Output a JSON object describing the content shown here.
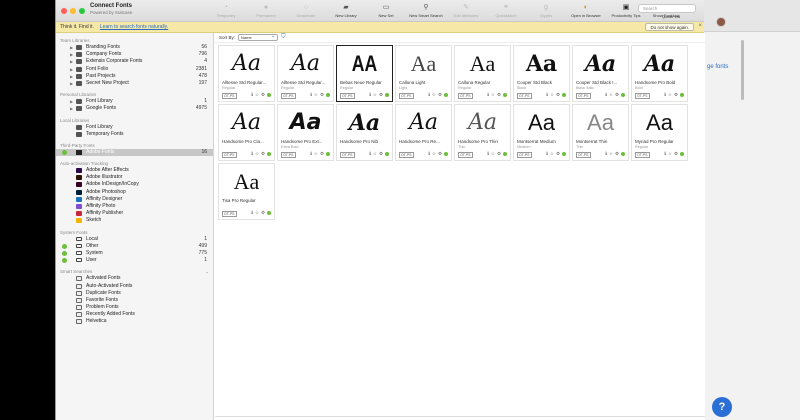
{
  "app": {
    "title": "Connect Fonts",
    "subtitle": "Powered by Suitcase"
  },
  "toolbar": [
    {
      "label": "Temporary",
      "icon": "temporary-icon",
      "dim": true
    },
    {
      "label": "Permanent",
      "icon": "permanent-icon",
      "dim": true
    },
    {
      "label": "Deactivate",
      "icon": "deactivate-icon",
      "dim": true
    },
    {
      "label": "New Library",
      "icon": "new-library-icon",
      "dim": false
    },
    {
      "label": "New Set",
      "icon": "new-set-icon",
      "dim": false
    },
    {
      "label": "New Smart Search",
      "icon": "smart-search-icon",
      "dim": false
    },
    {
      "label": "Edit Attributes",
      "icon": "edit-attributes-icon",
      "dim": true
    },
    {
      "label": "QuickMatch",
      "icon": "quickmatch-icon",
      "dim": true
    },
    {
      "label": "Glyphs",
      "icon": "glyphs-icon",
      "dim": true
    },
    {
      "label": "Open in Browser",
      "icon": "open-browser-icon",
      "dim": false
    },
    {
      "label": "Productivity Tips",
      "icon": "productivity-tips-icon",
      "dim": false
    },
    {
      "label": "Show Font List",
      "icon": "font-list-icon",
      "dim": false
    }
  ],
  "search": {
    "placeholder": "Search",
    "quickfind": "QuickFind"
  },
  "banner": {
    "text": "Think it. Find it.",
    "link": "Learn to search fonts naturally.",
    "dismiss": "Do not show again.",
    "close": "×"
  },
  "sidebar": {
    "team_libraries": {
      "header": "Team Libraries",
      "items": [
        {
          "label": "Branding Fonts",
          "count": "56"
        },
        {
          "label": "Company Fonts",
          "count": "796"
        },
        {
          "label": "Extensis Corporate Fonts",
          "count": "4"
        },
        {
          "label": "Font Folio",
          "count": "2381"
        },
        {
          "label": "Past Projects",
          "count": "478"
        },
        {
          "label": "Secret New Project",
          "count": "197"
        }
      ]
    },
    "personal_libraries": {
      "header": "Personal Libraries",
      "items": [
        {
          "label": "Font Library",
          "count": "1"
        },
        {
          "label": "Google Fonts",
          "count": "4975"
        }
      ]
    },
    "local_libraries": {
      "header": "Local Libraries",
      "items": [
        {
          "label": "Font Library",
          "count": ""
        },
        {
          "label": "Temporary Fonts",
          "count": ""
        }
      ]
    },
    "third_party": {
      "header": "Third-Party Fonts",
      "items": [
        {
          "label": "Adobe Fonts",
          "count": "16"
        }
      ]
    },
    "auto_activation": {
      "header": "Auto-activation Tracking",
      "items": [
        {
          "label": "Adobe After Effects",
          "color": "#2a0a4a",
          "fg": "#b58cff"
        },
        {
          "label": "Adobe Illustrator",
          "color": "#2b1500",
          "fg": "#ff9a00"
        },
        {
          "label": "Adobe InDesign/InCopy",
          "color": "#3a0020",
          "fg": "#ff3d8c"
        },
        {
          "label": "Adobe Photoshop",
          "color": "#001e36",
          "fg": "#31a8ff"
        },
        {
          "label": "Affinity Designer",
          "color": "#1b72be",
          "fg": "#ffffff"
        },
        {
          "label": "Affinity Photo",
          "color": "#7e4dd2",
          "fg": "#ffffff"
        },
        {
          "label": "Affinity Publisher",
          "color": "#c9283e",
          "fg": "#ffffff"
        },
        {
          "label": "Sketch",
          "color": "#f7b500",
          "fg": "#ffffff"
        }
      ]
    },
    "system_fonts": {
      "header": "System Fonts",
      "items": [
        {
          "label": "Local",
          "count": "1"
        },
        {
          "label": "Other",
          "count": "499"
        },
        {
          "label": "System",
          "count": "775"
        },
        {
          "label": "User",
          "count": "1"
        }
      ]
    },
    "smart_searches": {
      "header": "Smart Searches",
      "items": [
        {
          "label": "Activated Fonts"
        },
        {
          "label": "Auto-Activated Fonts"
        },
        {
          "label": "Duplicate Fonts"
        },
        {
          "label": "Favorite Fonts"
        },
        {
          "label": "Problem Fonts"
        },
        {
          "label": "Recently Added Fonts"
        },
        {
          "label": "Helvetica"
        }
      ]
    }
  },
  "sort": {
    "label": "Sort By:",
    "value": "Name"
  },
  "fonts": [
    {
      "preview": "Aa",
      "name": "Alltesse Std Regular...",
      "style": "Regular",
      "badge": "OT-PS",
      "look": "script"
    },
    {
      "preview": "Aa",
      "name": "Alltesse Std Regular...",
      "style": "Regular",
      "badge": "OT-PS",
      "look": "script"
    },
    {
      "preview": "AA",
      "name": "Bebas Neue Regular",
      "style": "Regular",
      "badge": "OT-PS",
      "look": "condensed"
    },
    {
      "preview": "Aa",
      "name": "Calluna Light",
      "style": "Light",
      "badge": "OT-PS",
      "look": "serif-light"
    },
    {
      "preview": "Aa",
      "name": "Calluna Regular",
      "style": "Regular",
      "badge": "OT-PS",
      "look": "serif"
    },
    {
      "preview": "Aa",
      "name": "Cooper Std Black",
      "style": "Black",
      "badge": "OT-PS",
      "look": "cooper"
    },
    {
      "preview": "Aa",
      "name": "Cooper Std Black I...",
      "style": "Black Italic",
      "badge": "OT-PS",
      "look": "cooper-italic"
    },
    {
      "preview": "Aa",
      "name": "Handsome Pro Bold",
      "style": "Bold",
      "badge": "OT-PS",
      "look": "hand-bold"
    },
    {
      "preview": "Aa",
      "name": "Handsome Pro Cla...",
      "style": "",
      "badge": "OT-PS",
      "look": "hand"
    },
    {
      "preview": "Aa",
      "name": "Handsome Pro Ext...",
      "style": "Extra Bold",
      "badge": "OT-PS",
      "look": "hand-xbold"
    },
    {
      "preview": "Aa",
      "name": "Handsome Pro Nib",
      "style": "",
      "badge": "OT-PS",
      "look": "hand-bold"
    },
    {
      "preview": "Aa",
      "name": "Handsome Pro Re...",
      "style": "",
      "badge": "OT-PS",
      "look": "hand"
    },
    {
      "preview": "Aa",
      "name": "Handsome Pro Thin",
      "style": "Thin",
      "badge": "OT-PS",
      "look": "hand-thin"
    },
    {
      "preview": "Aa",
      "name": "Montserrat Medium",
      "style": "Medium",
      "badge": "OT-PS",
      "look": "sans-medium"
    },
    {
      "preview": "Aa",
      "name": "Montserrat Thin",
      "style": "Thin",
      "badge": "OT-PS",
      "look": "sans-thin"
    },
    {
      "preview": "Aa",
      "name": "Myriad Pro Regular",
      "style": "Regular",
      "badge": "OT-PS",
      "look": "sans"
    },
    {
      "preview": "Aa",
      "name": "Tisa Pro Regular",
      "style": "",
      "badge": "OT-PS",
      "look": "serif"
    }
  ],
  "colors": {
    "banner": "#f6e9a7",
    "active_dot": "#6bbf3a",
    "link": "#2a6cc4",
    "selection": "#c7c7c7"
  },
  "background_page": {
    "text": "ge fonts",
    "help": "?"
  }
}
